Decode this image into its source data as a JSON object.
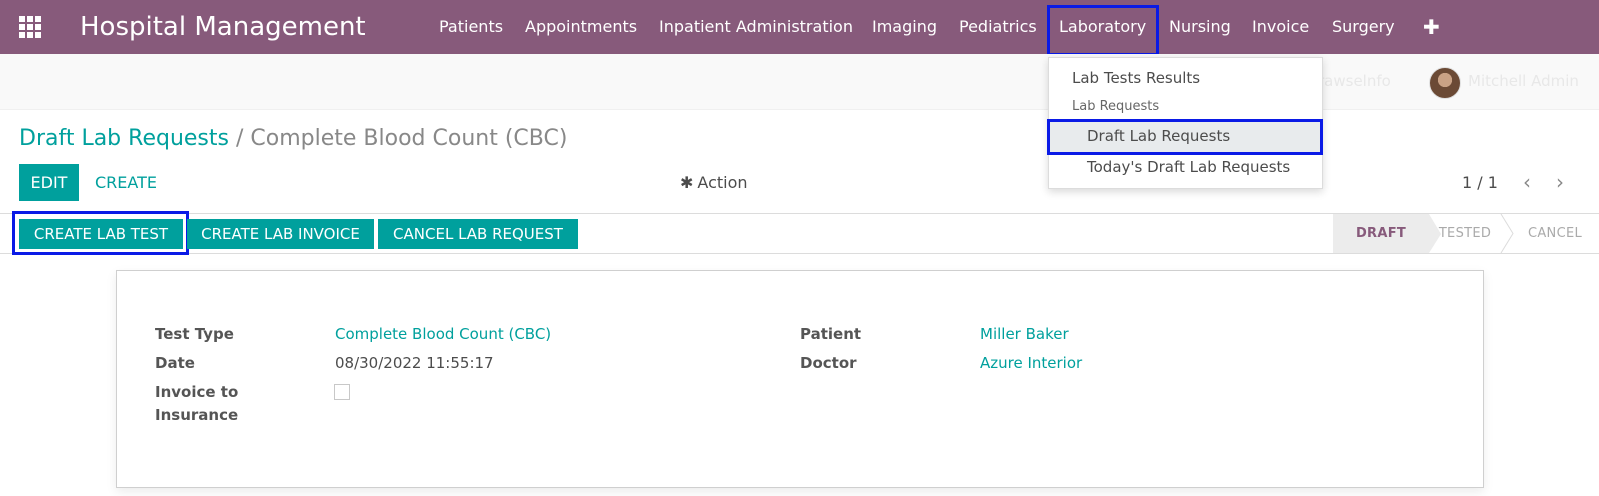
{
  "navbar": {
    "apps_icon": "apps-grid-icon",
    "brand": "Hospital Management",
    "menu": [
      "Patients",
      "Appointments",
      "Inpatient Administration",
      "Imaging",
      "Pediatrics",
      "Laboratory",
      "Nursing",
      "Invoice",
      "Surgery"
    ],
    "plus_icon": "plus-icon"
  },
  "user": {
    "faint_text": "Mitchell Admin",
    "faint_db": "rawselnfo"
  },
  "laboratory_menu": {
    "items": [
      "Lab Tests Results"
    ],
    "section_header": "Lab Requests",
    "sub_items": [
      "Draft Lab Requests",
      "Today's Draft Lab Requests"
    ]
  },
  "breadcrumb": {
    "parent": "Draft Lab Requests",
    "separator": "/",
    "current": "Complete Blood Count (CBC)"
  },
  "buttons": {
    "edit": "EDIT",
    "create": "CREATE",
    "action": "Action",
    "action_icon": "gear-icon"
  },
  "pager": {
    "value": "1 / 1",
    "prev": "‹",
    "next": "›"
  },
  "status_buttons": [
    "CREATE LAB TEST",
    "CREATE LAB INVOICE",
    "CANCEL LAB REQUEST"
  ],
  "stages": {
    "draft": "DRAFT",
    "tested": "TESTED",
    "cancel": "CANCEL",
    "active": "DRAFT"
  },
  "form": {
    "test_type_label": "Test Type",
    "test_type_value": "Complete Blood Count (CBC)",
    "date_label": "Date",
    "date_value": "08/30/2022 11:55:17",
    "invoice_label_line1": "Invoice to",
    "invoice_label_line2": "Insurance",
    "invoice_checked": false,
    "patient_label": "Patient",
    "patient_value": "Miller Baker",
    "doctor_label": "Doctor",
    "doctor_value": "Azure Interior"
  },
  "colors": {
    "navbar": "#875a7b",
    "primary": "#00a09d",
    "highlight": "#0a1ae6"
  }
}
